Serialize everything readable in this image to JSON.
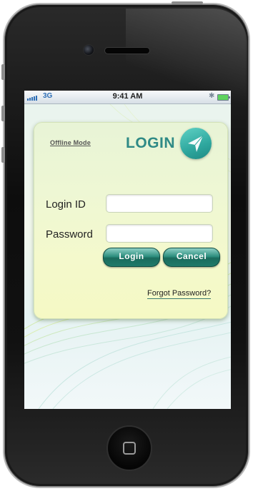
{
  "status_bar": {
    "carrier": "3G",
    "time": "9:41 AM",
    "bluetooth_icon": "bluetooth-icon",
    "battery_icon": "battery-icon"
  },
  "login_panel": {
    "offline_link": "Offline Mode",
    "title": "LOGIN",
    "logo_icon": "paper-plane-icon",
    "login_id_label": "Login ID",
    "login_id_value": "",
    "password_label": "Password",
    "password_value": "",
    "login_button": "Login",
    "cancel_button": "Cancel",
    "forgot_link": "Forgot Password?"
  },
  "colors": {
    "accent": "#2e8f7f",
    "brand_text": "#2f8a86",
    "panel": "#eef7d4"
  }
}
